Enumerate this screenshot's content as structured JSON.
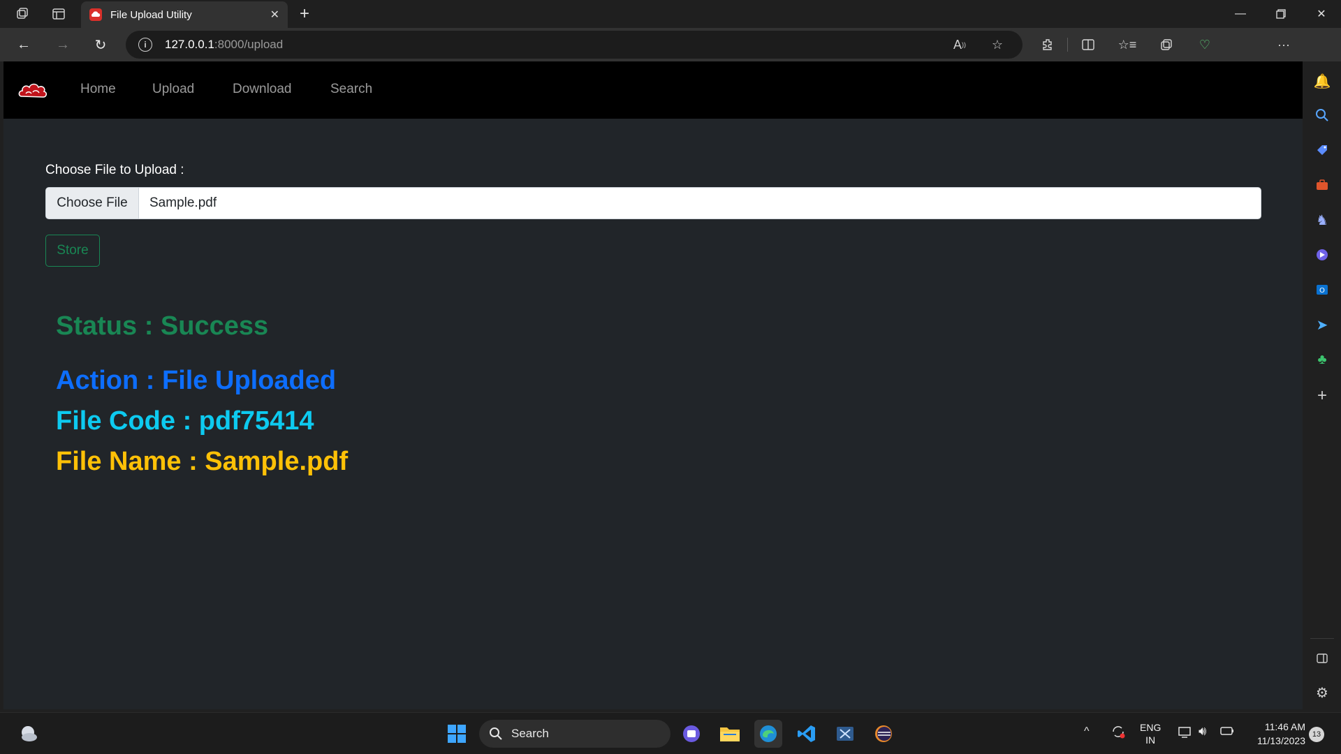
{
  "browser": {
    "tab_title": "File Upload Utility",
    "url_host": "127.0.0.1",
    "url_path": ":8000/upload"
  },
  "site_nav": {
    "links": [
      "Home",
      "Upload",
      "Download",
      "Search"
    ]
  },
  "form": {
    "label": "Choose File to Upload :",
    "choose_button": "Choose File",
    "selected_file": "Sample.pdf",
    "submit_button": "Store"
  },
  "result": {
    "status": "Status : Success",
    "action": "Action : File Uploaded",
    "file_code": "File Code : pdf75414",
    "file_name": "File Name : Sample.pdf"
  },
  "colors": {
    "status": "#198754",
    "action": "#0d6efd",
    "file_code": "#0dcaf0",
    "file_name": "#ffc107",
    "page_bg": "#212529",
    "nav_bg": "#000000"
  },
  "taskbar": {
    "search_label": "Search",
    "lang_top": "ENG",
    "lang_bottom": "IN",
    "time": "11:46 AM",
    "date": "11/13/2023",
    "notification_count": "13"
  }
}
